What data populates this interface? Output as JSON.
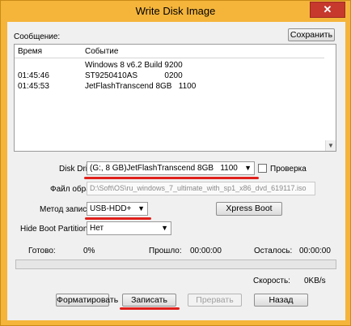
{
  "window": {
    "title": "Write Disk Image",
    "close_symbol": "✕"
  },
  "messages": {
    "label": "Сообщение:",
    "save_button": "Сохранить",
    "col_time": "Время",
    "col_event": "Событие",
    "rows": [
      {
        "time": "",
        "event": "Windows 8 v6.2 Build 9200"
      },
      {
        "time": "01:45:46",
        "event": "ST9250410AS            0200"
      },
      {
        "time": "01:45:53",
        "event": "JetFlashTranscend 8GB   1100"
      }
    ]
  },
  "disk_drive": {
    "label": "Disk Drive:",
    "value": "(G:, 8 GB)JetFlashTranscend 8GB   1100",
    "verify_label": "Проверка"
  },
  "image_file": {
    "label": "Файл образа:",
    "value": "D:\\Soft\\OS\\ru_windows_7_ultimate_with_sp1_x86_dvd_619117.iso"
  },
  "write_method": {
    "label": "Метод записи:",
    "value": "USB-HDD+",
    "xpress_boot_button": "Xpress Boot"
  },
  "hide_boot": {
    "label": "Hide Boot Partition:",
    "value": "Нет"
  },
  "progress": {
    "done_label": "Готово:",
    "done_value": "0%",
    "elapsed_label": "Прошло:",
    "elapsed_value": "00:00:00",
    "remaining_label": "Осталось:",
    "remaining_value": "00:00:00",
    "percent": 0,
    "speed_label": "Скорость:",
    "speed_value": "0KB/s"
  },
  "actions": {
    "format_button": "Форматировать",
    "write_button": "Записать",
    "abort_button": "Прервать",
    "back_button": "Назад"
  },
  "colors": {
    "title_bar": "#f5b53b",
    "close_button": "#c7382d",
    "highlight_underline": "#e0201c"
  }
}
